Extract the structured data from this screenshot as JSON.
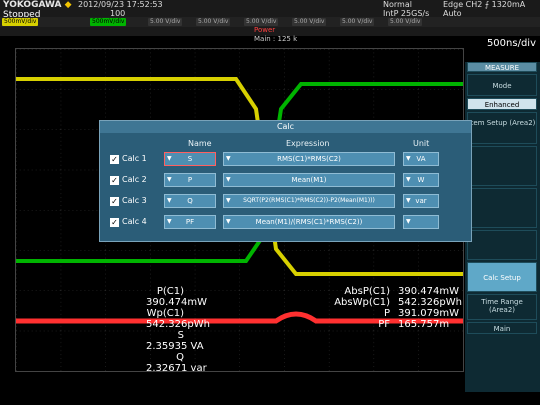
{
  "header": {
    "brand": "YOKOGAWA",
    "status": "Stopped",
    "date": "2012/09/23 17:52:53",
    "count": "100",
    "mode": "Normal",
    "sample": "IntP 25GS/s",
    "trigger": "Edge CH2 ⨍ 1320mA",
    "trigger_mode": "Auto",
    "channels": [
      "500mV/div",
      "500mV/div",
      "5.00 V/div",
      "5.00 V/div",
      "5.00 V/div",
      "5.00 V/div",
      "5.00 V/div",
      "5.00 V/div"
    ],
    "power_label": "Power",
    "main_label": "Main : 125 k",
    "timebase": "500ns/div"
  },
  "side_menu": {
    "title": "MEASURE",
    "items": [
      "Mode",
      "Enhanced",
      "Item Setup (Area2)",
      "",
      "",
      "",
      "Calc Setup",
      "Time Range (Area2)",
      "Main"
    ]
  },
  "dialog": {
    "title": "Calc",
    "headers": {
      "name": "Name",
      "expression": "Expression",
      "unit": "Unit"
    },
    "rows": [
      {
        "label": "Calc 1",
        "name": "S",
        "expression": "RMS(C1)*RMS(C2)",
        "unit": "VA"
      },
      {
        "label": "Calc 2",
        "name": "P",
        "expression": "Mean(M1)",
        "unit": "W"
      },
      {
        "label": "Calc 3",
        "name": "Q",
        "expression": "SQRT(P2(RMS(C1)*RMS(C2))-P2(Mean(M1)))",
        "unit": "var"
      },
      {
        "label": "Calc 4",
        "name": "PF",
        "expression": "Mean(M1)/(RMS(C1)*RMS(C2))",
        "unit": ""
      }
    ]
  },
  "measurements": {
    "left": [
      {
        "label": "P(C1)",
        "value": "390.474mW"
      },
      {
        "label": "Wp(C1)",
        "value": "542.326pWh"
      },
      {
        "label": "S",
        "value": "2.35935 VA"
      },
      {
        "label": "Q",
        "value": "2.32671 var"
      }
    ],
    "right": [
      {
        "label": "AbsP(C1)",
        "value": "390.474mW"
      },
      {
        "label": "AbsWp(C1)",
        "value": "542.326pWh"
      },
      {
        "label": "P",
        "value": "391.079mW"
      },
      {
        "label": "PF",
        "value": "165.757m"
      }
    ]
  },
  "colors": {
    "ch1": "#d7d000",
    "ch2": "#00b400",
    "math": "#ff3030",
    "grid": "#333333"
  }
}
